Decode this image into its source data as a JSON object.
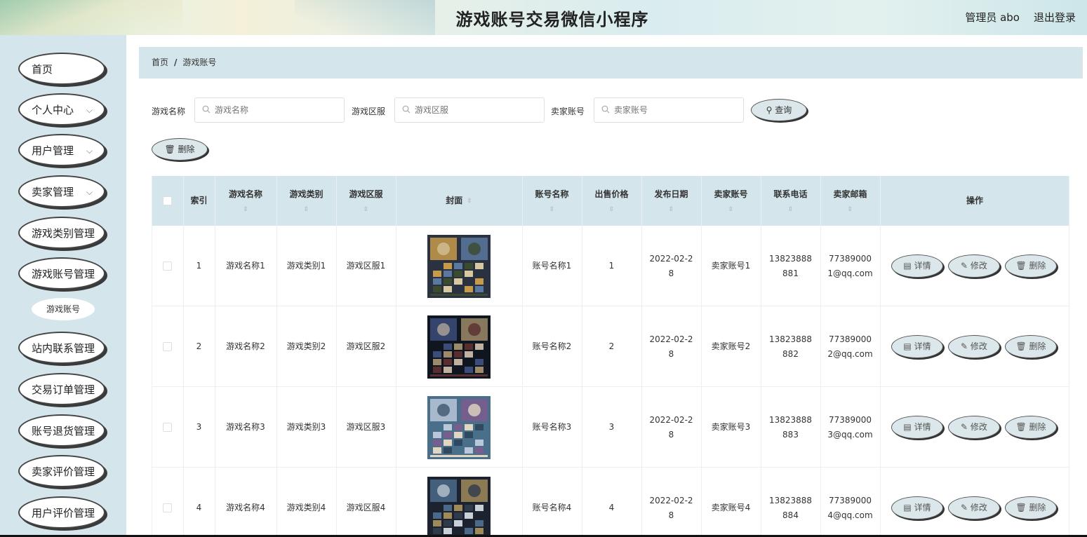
{
  "header": {
    "title": "游戏账号交易微信小程序",
    "user": "管理员 abo",
    "logout": "退出登录"
  },
  "sidebar": {
    "items": [
      {
        "label": "首页",
        "has_children": false
      },
      {
        "label": "个人中心",
        "has_children": true
      },
      {
        "label": "用户管理",
        "has_children": true
      },
      {
        "label": "卖家管理",
        "has_children": true
      },
      {
        "label": "游戏类别管理",
        "has_children": false
      },
      {
        "label": "游戏账号管理",
        "has_children": false
      },
      {
        "label": "站内联系管理",
        "has_children": false
      },
      {
        "label": "交易订单管理",
        "has_children": false
      },
      {
        "label": "账号退货管理",
        "has_children": false
      },
      {
        "label": "卖家评价管理",
        "has_children": false
      },
      {
        "label": "用户评价管理",
        "has_children": false
      }
    ],
    "sub_item": "游戏账号"
  },
  "breadcrumb": {
    "home": "首页",
    "separator": "/",
    "current": "游戏账号"
  },
  "search": {
    "game_name_label": "游戏名称",
    "game_name_placeholder": "游戏名称",
    "game_zone_label": "游戏区服",
    "game_zone_placeholder": "游戏区服",
    "seller_label": "卖家账号",
    "seller_placeholder": "卖家账号",
    "query_button": "查询"
  },
  "toolbar": {
    "delete_button": "删除"
  },
  "table": {
    "headers": {
      "index": "索引",
      "game_name": "游戏名称",
      "game_category": "游戏类别",
      "game_zone": "游戏区服",
      "cover": "封面",
      "account_name": "账号名称",
      "price": "出售价格",
      "publish_date": "发布日期",
      "seller": "卖家账号",
      "phone": "联系电话",
      "email": "卖家邮箱",
      "actions": "操作"
    },
    "rows": [
      {
        "index": "1",
        "game_name": "游戏名称1",
        "game_category": "游戏类别1",
        "game_zone": "游戏区服1",
        "account_name": "账号名称1",
        "price": "1",
        "date_line1": "2022-02-2",
        "date_line2": "8",
        "seller": "卖家账号1",
        "phone_line1": "13823888",
        "phone_line2": "881",
        "email_line1": "77389000",
        "email_line2": "1@qq.com"
      },
      {
        "index": "2",
        "game_name": "游戏名称2",
        "game_category": "游戏类别2",
        "game_zone": "游戏区服2",
        "account_name": "账号名称2",
        "price": "2",
        "date_line1": "2022-02-2",
        "date_line2": "8",
        "seller": "卖家账号2",
        "phone_line1": "13823888",
        "phone_line2": "882",
        "email_line1": "77389000",
        "email_line2": "2@qq.com"
      },
      {
        "index": "3",
        "game_name": "游戏名称3",
        "game_category": "游戏类别3",
        "game_zone": "游戏区服3",
        "account_name": "账号名称3",
        "price": "3",
        "date_line1": "2022-02-2",
        "date_line2": "8",
        "seller": "卖家账号3",
        "phone_line1": "13823888",
        "phone_line2": "883",
        "email_line1": "77389000",
        "email_line2": "3@qq.com"
      },
      {
        "index": "4",
        "game_name": "游戏名称4",
        "game_category": "游戏类别4",
        "game_zone": "游戏区服4",
        "account_name": "账号名称4",
        "price": "4",
        "date_line1": "2022-02-2",
        "date_line2": "8",
        "seller": "卖家账号4",
        "phone_line1": "13823888",
        "phone_line2": "884",
        "email_line1": "77389000",
        "email_line2": "4@qq.com"
      }
    ],
    "actions": {
      "detail": "详情",
      "edit": "修改",
      "delete": "删除"
    }
  }
}
